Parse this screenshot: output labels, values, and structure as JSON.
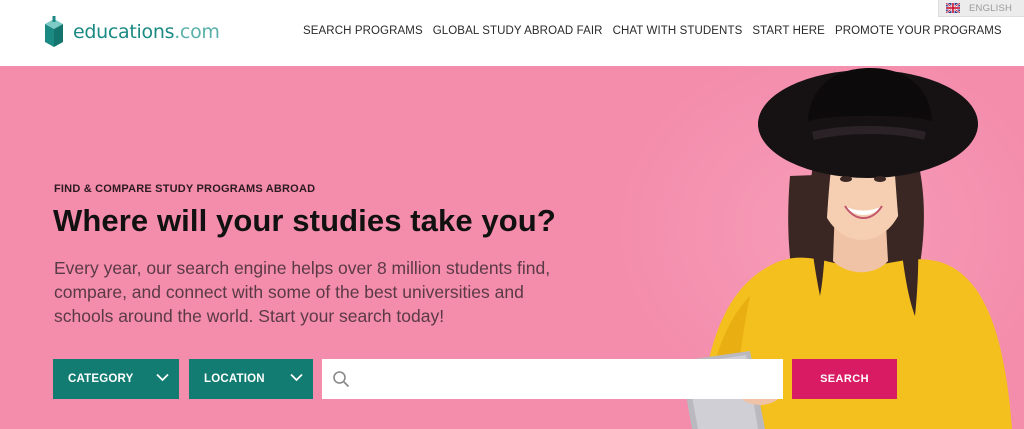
{
  "header": {
    "logo": {
      "name": "educations",
      "suffix": ".com"
    },
    "nav": [
      {
        "label": "SEARCH PROGRAMS"
      },
      {
        "label": "GLOBAL STUDY ABROAD FAIR"
      },
      {
        "label": "CHAT WITH STUDENTS"
      },
      {
        "label": "START HERE"
      },
      {
        "label": "PROMOTE YOUR PROGRAMS"
      }
    ],
    "language": {
      "label": "ENGLISH",
      "flag_icon": "uk-flag-icon"
    }
  },
  "hero": {
    "eyebrow": "FIND & COMPARE STUDY PROGRAMS ABROAD",
    "headline": "Where will your studies take you?",
    "lead": "Every year, our search engine helps over 8 million students find, compare, and connect with some of the best universities and schools around the world. Start your search today!",
    "background_color": "#f48cab",
    "image": "smiling-student-with-hat-photo"
  },
  "search": {
    "category_label": "CATEGORY",
    "location_label": "LOCATION",
    "query_value": "",
    "query_placeholder": "",
    "button_label": "SEARCH",
    "icons": {
      "dropdown": "chevron-down-icon",
      "search": "search-icon"
    }
  },
  "colors": {
    "accent": "#127c72",
    "search_button": "#d91b63",
    "logo": "#1b8a83"
  }
}
